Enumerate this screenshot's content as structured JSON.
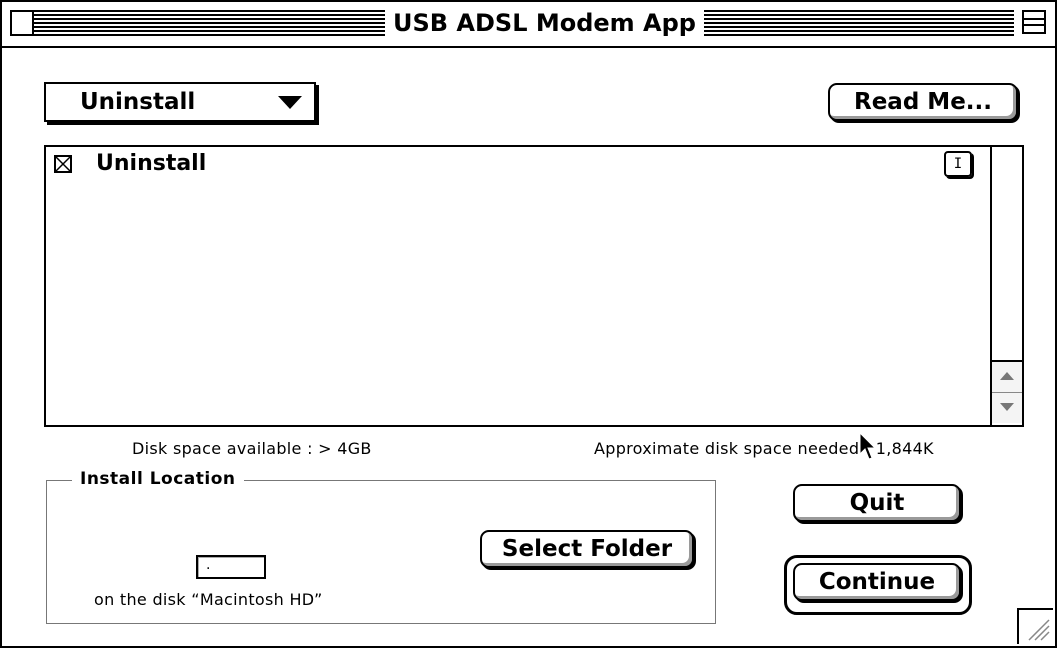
{
  "window": {
    "title": "USB ADSL Modem App"
  },
  "toolbar": {
    "install_type_selected": "Uninstall",
    "read_me_label": "Read Me..."
  },
  "package_list": {
    "items": [
      {
        "label": "Uninstall",
        "checked": true,
        "info_glyph": "I"
      }
    ]
  },
  "disk_info": {
    "available": "Disk space available : > 4GB",
    "needed": "Approximate disk space needed : 1,844K"
  },
  "install_location": {
    "title": "Install Location",
    "folder_value": ".",
    "disk_text": "on the disk “Macintosh HD”",
    "select_folder_label": "Select Folder"
  },
  "actions": {
    "quit_label": "Quit",
    "continue_label": "Continue"
  },
  "icons": {
    "close": "close-box-icon",
    "collapse": "collapse-box-icon",
    "popup_arrow": "triangle-down-icon",
    "checkbox": "checkbox-checked-icon",
    "info": "info-icon",
    "scroll_up": "scroll-up-arrow-icon",
    "scroll_down": "scroll-down-arrow-icon",
    "resize": "resize-grip-icon",
    "cursor": "mouse-pointer-icon"
  }
}
